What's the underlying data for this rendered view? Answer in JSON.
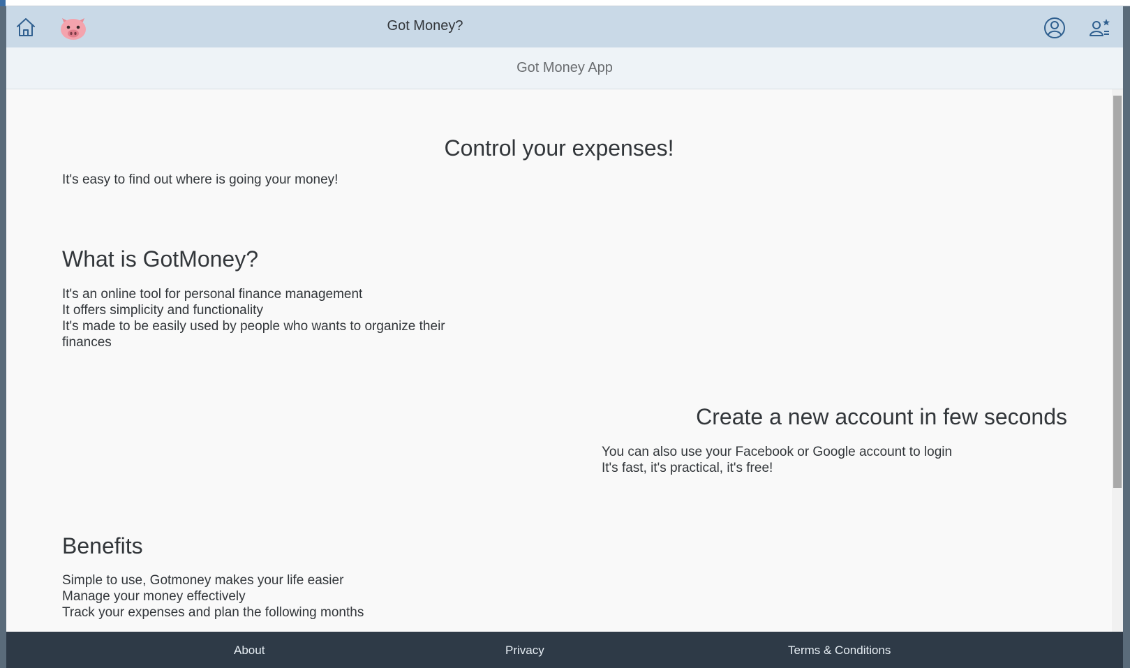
{
  "shell": {
    "title": "Got Money?",
    "home_icon": "home-icon",
    "logo": "pig-logo",
    "user_icon": "user-circle-icon",
    "favorites_icon": "user-favorites-icon"
  },
  "subheader": {
    "title": "Got Money App"
  },
  "sections": {
    "hero": {
      "title": "Control your expenses!",
      "text": "It's easy to find out where is going your money!"
    },
    "what": {
      "title": "What is GotMoney?",
      "lines": [
        "It's an online tool for personal finance management",
        "It offers simplicity and functionality",
        "It's made to be easily used by people who wants to organize their finances"
      ]
    },
    "create": {
      "title": "Create a new account in few seconds",
      "lines": [
        "You can also use your Facebook or Google account to login",
        "It's fast, it's practical, it's free!"
      ]
    },
    "benefits": {
      "title": "Benefits",
      "lines": [
        "Simple to use, Gotmoney makes your life easier",
        "Manage your money effectively",
        "Track your expenses and plan the following months"
      ]
    }
  },
  "footer": {
    "about": "About",
    "privacy": "Privacy",
    "terms": "Terms & Conditions"
  },
  "colors": {
    "shellbar": "#c9d9e7",
    "subheader": "#eef3f7",
    "footer": "#2e3a47",
    "text": "#32363a"
  }
}
